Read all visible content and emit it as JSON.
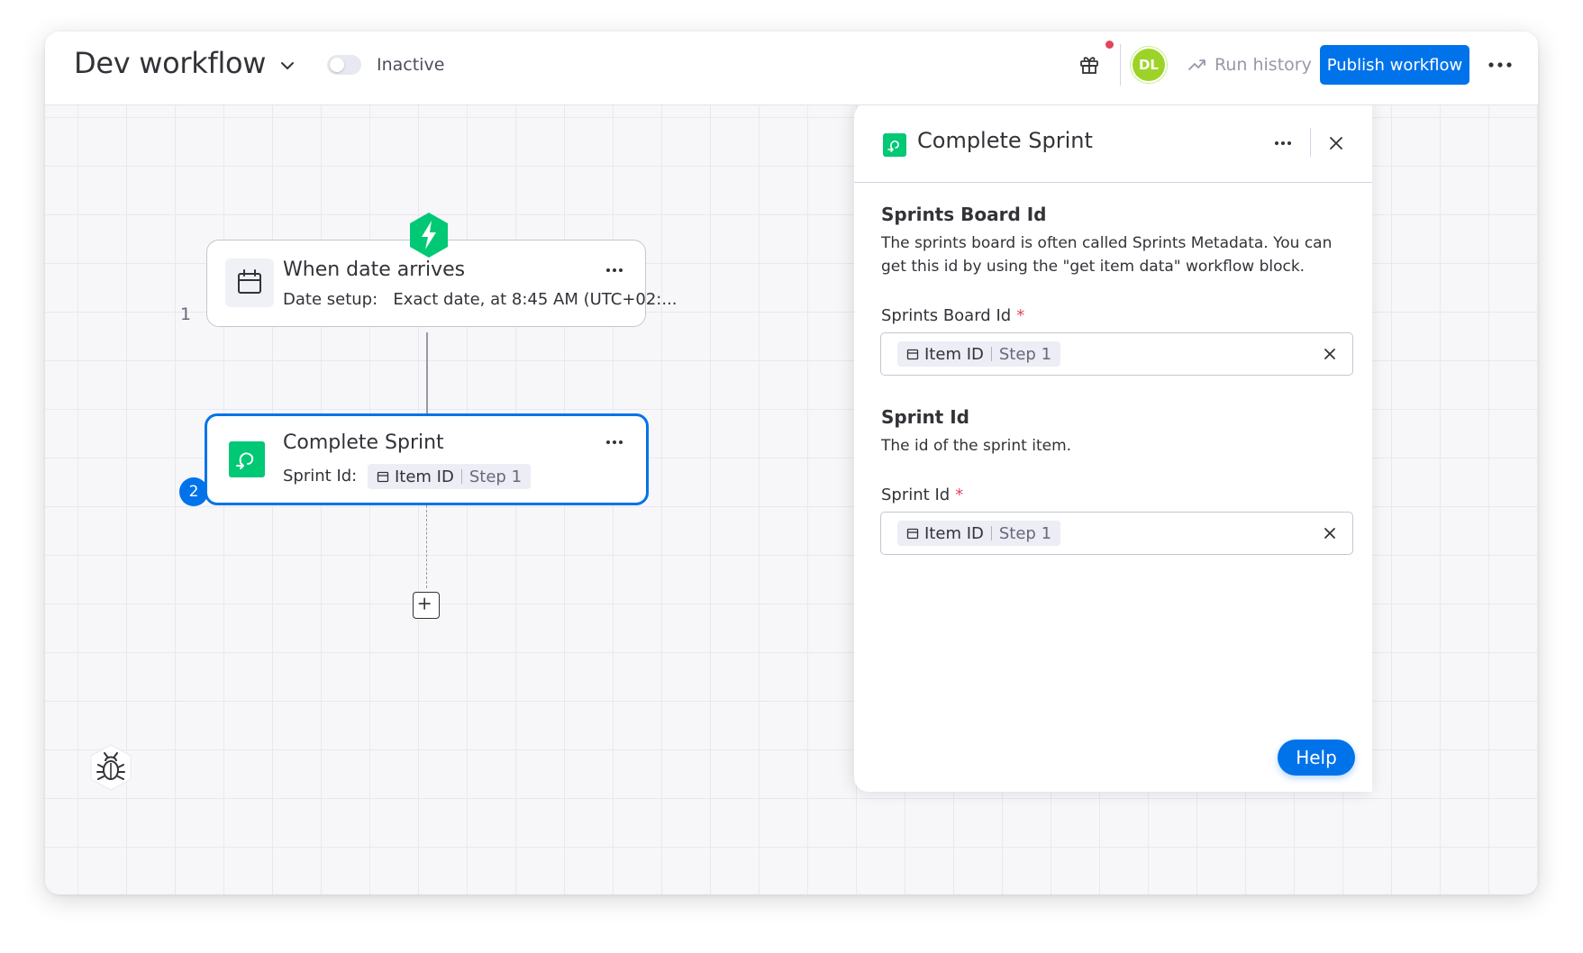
{
  "header": {
    "title": "Dev workflow",
    "status_label": "Inactive",
    "avatar_initials": "DL",
    "run_history_label": "Run history",
    "publish_label": "Publish workflow"
  },
  "canvas": {
    "steps": [
      {
        "number": "1",
        "title": "When date arrives",
        "detail_label": "Date setup:",
        "detail_value": "Exact date, at 8:45 AM (UTC+02:..."
      },
      {
        "number": "2",
        "title": "Complete Sprint",
        "detail_label": "Sprint Id:",
        "chip_label": "Item ID",
        "chip_step": "Step 1"
      }
    ]
  },
  "panel": {
    "title": "Complete Sprint",
    "fields": [
      {
        "section_title": "Sprints Board Id",
        "description": "The sprints board is often called Sprints Metadata. You can get this id by using the \"get item data\" workflow block.",
        "label": "Sprints Board Id",
        "required_mark": "*",
        "chip_label": "Item ID",
        "chip_step": "Step 1"
      },
      {
        "section_title": "Sprint Id",
        "description": "The id of the sprint item.",
        "label": "Sprint Id",
        "required_mark": "*",
        "chip_label": "Item ID",
        "chip_step": "Step 1"
      }
    ],
    "help_label": "Help"
  },
  "colors": {
    "accent": "#0073ea",
    "trigger_green": "#00c875",
    "avatar_green": "#9cd326",
    "required_red": "#e2445c"
  },
  "icons": [
    "chevron-down-icon",
    "gift-icon",
    "trend-icon",
    "more-icon",
    "calendar-icon",
    "lightning-icon",
    "sprint-icon",
    "plus-icon",
    "bug-icon",
    "close-icon"
  ]
}
